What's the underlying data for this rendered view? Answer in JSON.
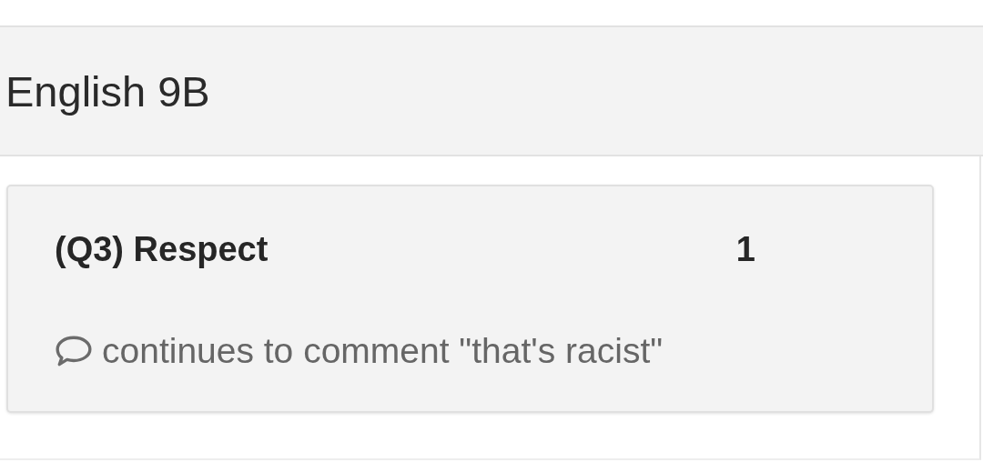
{
  "header": {
    "title": "English 9B"
  },
  "cards": [
    {
      "title": "(Q3) Respect",
      "points": "1",
      "comment": "continues to comment \"that's racist\""
    }
  ]
}
